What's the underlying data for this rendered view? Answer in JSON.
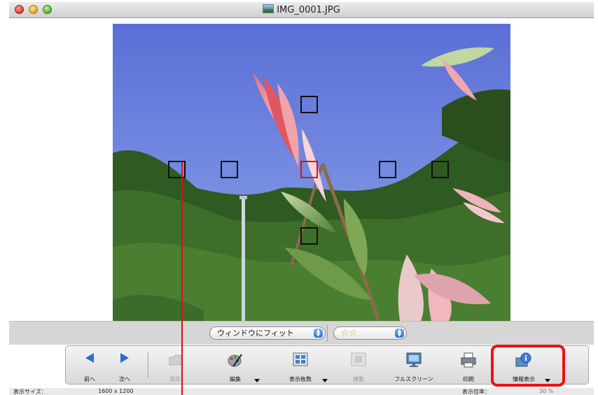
{
  "window": {
    "title": "IMG_0001.JPG"
  },
  "viewer": {
    "af_points": [
      {
        "name": "af-point-left-outer",
        "active": false
      },
      {
        "name": "af-point-left-inner",
        "active": false
      },
      {
        "name": "af-point-top",
        "active": false
      },
      {
        "name": "af-point-center",
        "active": true
      },
      {
        "name": "af-point-right-inner",
        "active": false
      },
      {
        "name": "af-point-right-outer",
        "active": false
      },
      {
        "name": "af-point-bottom",
        "active": false
      }
    ]
  },
  "controls": {
    "fit_select": "ウィンドウにフィット",
    "rating_select": "☆☆"
  },
  "toolbar": {
    "prev": "前へ",
    "next": "次へ",
    "save": "保存",
    "edit": "編集",
    "display_count": "表示枚数",
    "link": "連動",
    "fullscreen": "フルスクリーン",
    "print": "印刷",
    "info": "情報表示"
  },
  "status": {
    "size_label": "表示サイズ：",
    "size_value": "1600 x 1200",
    "zoom_label": "表示倍率：",
    "zoom_value": "30 %"
  },
  "colors": {
    "highlight": "#e11111",
    "af_active": "#e01010",
    "accent_blue": "#2a6fd0"
  }
}
